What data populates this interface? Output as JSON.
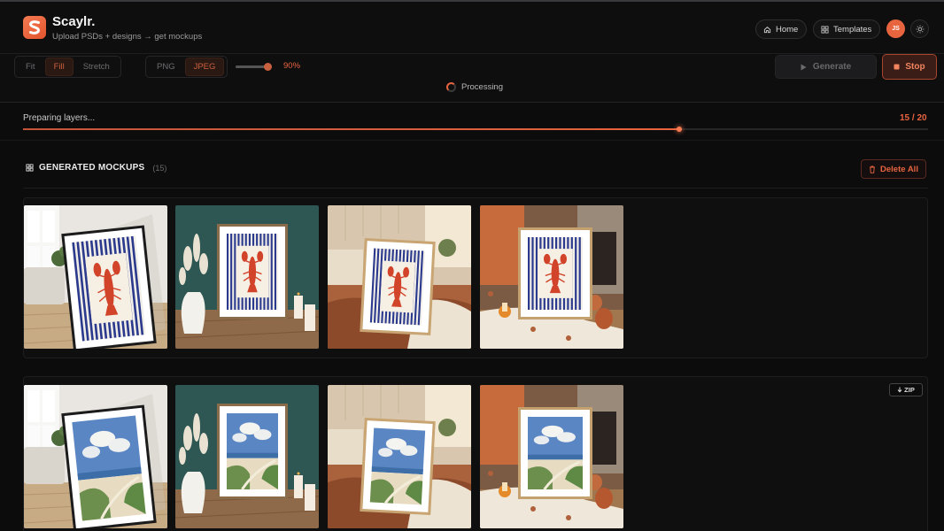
{
  "app": {
    "name": "Scaylr.",
    "tagline": "Upload PSDs + designs → get mockups",
    "logo_letter": "S"
  },
  "nav": {
    "home_label": "Home",
    "templates_label": "Templates",
    "avatar_initials": "JS",
    "home_icon": "home-icon",
    "templates_icon": "grid-icon",
    "theme_icon": "sun-icon"
  },
  "controls": {
    "fit_options": [
      {
        "label": "Fit",
        "active": false
      },
      {
        "label": "Fill",
        "active": true
      },
      {
        "label": "Stretch",
        "active": false
      }
    ],
    "format_options": [
      {
        "label": "PNG",
        "active": false
      },
      {
        "label": "JPEG",
        "active": true
      }
    ],
    "quality_label": "90%",
    "quality_value": 0.9,
    "generate_label": "Generate",
    "stop_label": "Stop",
    "processing_label": "Processing"
  },
  "progress": {
    "label": "Preparing layers...",
    "count": "15 / 20",
    "fraction": 0.725
  },
  "section": {
    "title": "GENERATED MOCKUPS",
    "count": "(15)",
    "delete_label": "Delete All"
  },
  "groups": [
    {
      "design": "lobster",
      "zip_label": "",
      "thumbs": [
        "living-room",
        "teal-wall",
        "bedroom",
        "fireplace"
      ]
    },
    {
      "design": "beach",
      "zip_label": "ZIP",
      "thumbs": [
        "living-room",
        "teal-wall",
        "bedroom",
        "fireplace"
      ]
    }
  ],
  "colors": {
    "accent": "#e8643f",
    "background": "#0c0c0d",
    "lobster_red": "#d2442a",
    "stripe_blue": "#2b3a8c"
  }
}
